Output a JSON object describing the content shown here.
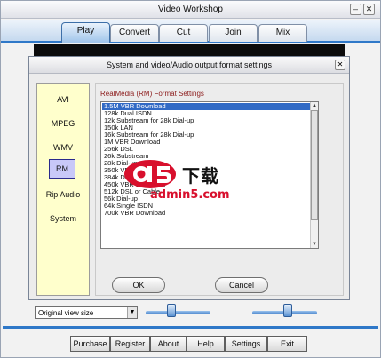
{
  "app": {
    "title": "Video Workshop"
  },
  "window_controls": {
    "minimize": "–",
    "close": "✕"
  },
  "tabs": [
    {
      "label": "Play",
      "active": true
    },
    {
      "label": "Convert"
    },
    {
      "label": "Cut"
    },
    {
      "label": "Join"
    },
    {
      "label": "Mix"
    }
  ],
  "dialog": {
    "title": "System and video/Audio output format settings",
    "close": "✕",
    "sidebar": [
      {
        "label": "AVI"
      },
      {
        "label": "MPEG"
      },
      {
        "label": "WMV"
      },
      {
        "label": "RM",
        "active": true
      },
      {
        "label": "Rip Audio"
      },
      {
        "label": "System"
      }
    ],
    "format_heading": "RealMedia (RM) Format Settings",
    "formats": [
      "1.5M VBR Download",
      "128k Dual ISDN",
      "12k Substream for 28k Dial-up",
      "150k LAN",
      "16k Substream for 28k Dial-up",
      "1M VBR Download",
      "256k DSL",
      "26k Substream",
      "28k Dial-up",
      "350k VBR",
      "384k DSL",
      "450k VBR Download",
      "512k DSL or Cable",
      "56k Dial-up",
      "64k Single ISDN",
      "700k VBR Download"
    ],
    "selected_format": "1.5M VBR Download",
    "scroll_up": "▲",
    "scroll_down": "▼",
    "ok_label": "OK",
    "cancel_label": "Cancel"
  },
  "watermark": {
    "logo_text": "a5",
    "title": "下载",
    "url": "admin5.com"
  },
  "view_size": {
    "value": "Original view size",
    "arrow": "▼"
  },
  "sliders": {
    "left_level": 0.38,
    "right_level": 0.55
  },
  "bottom_buttons": [
    "Purchase",
    "Register",
    "About",
    "Help",
    "Settings",
    "Exit"
  ],
  "colors": {
    "accent": "#2f78c8",
    "selection": "#316ac5",
    "sidebar_bg": "#ffffcc",
    "watermark_red": "#d8102d"
  }
}
